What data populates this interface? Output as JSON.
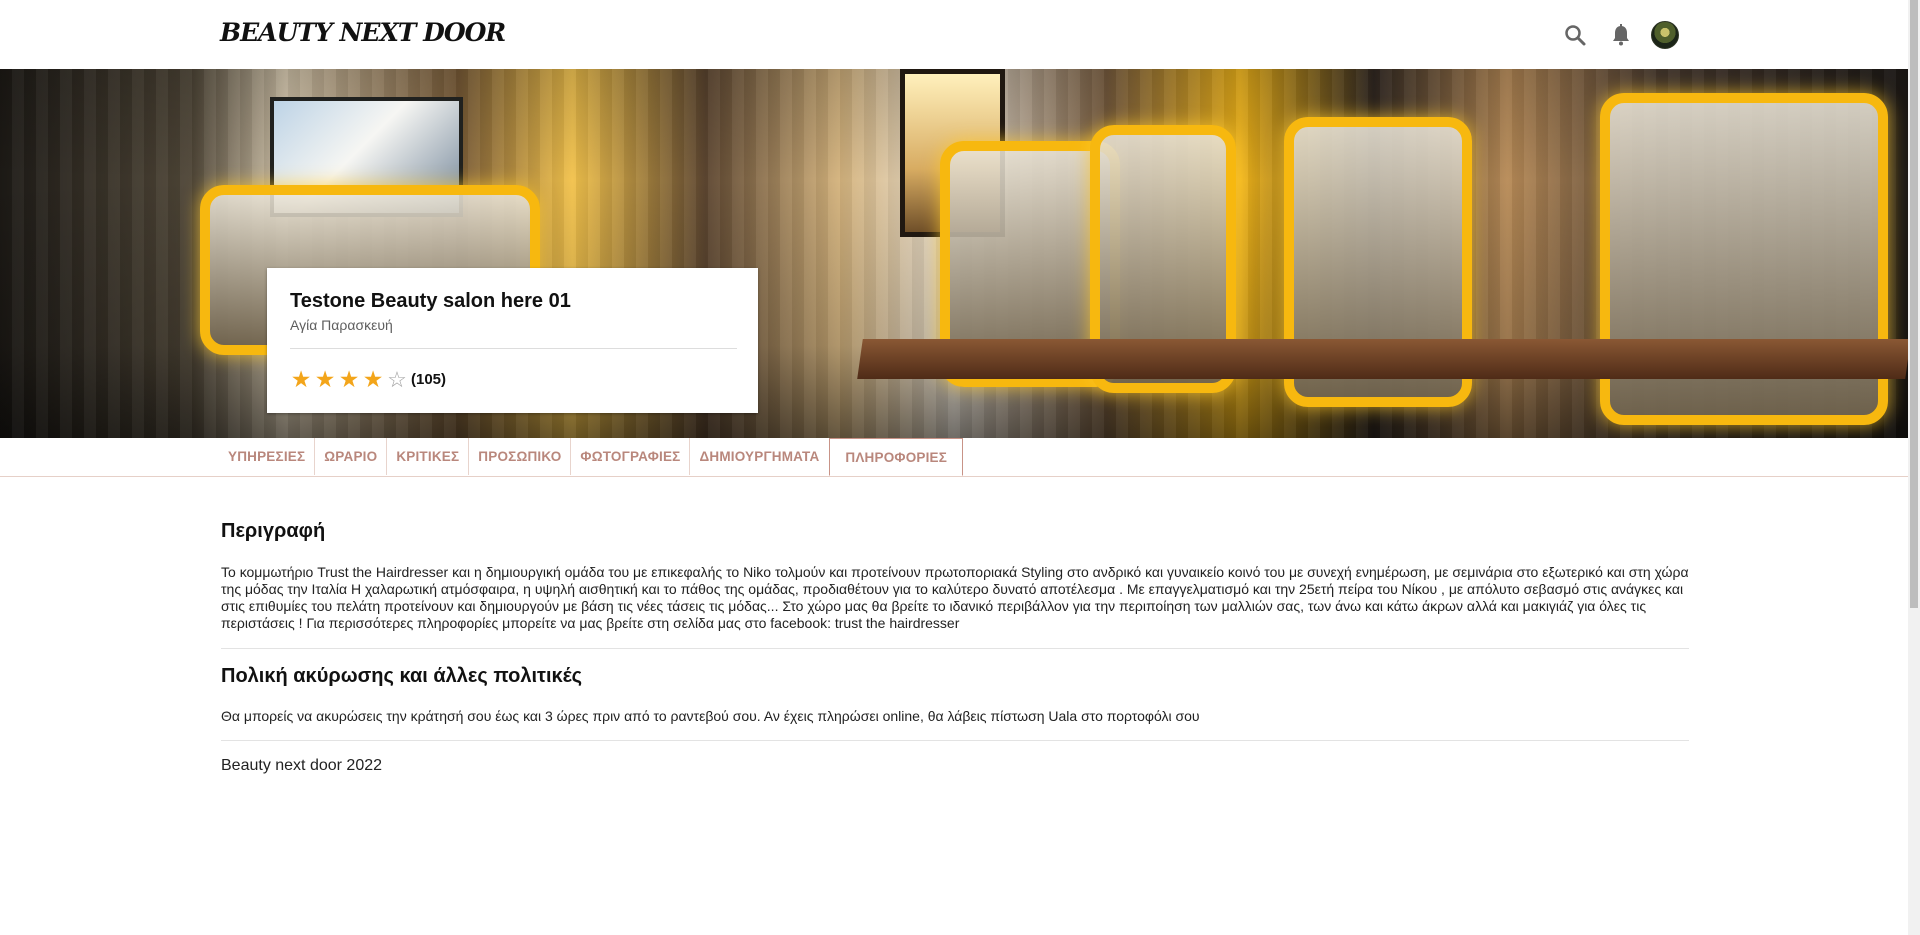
{
  "header": {
    "brand": "BEAUTY NEXT DOOR",
    "icons": [
      "search-icon",
      "bell-icon",
      "avatar"
    ]
  },
  "salon": {
    "name": "Testone Beauty salon here 01",
    "location": "Αγία Παρασκευή",
    "rating": 4,
    "rating_max": 5,
    "review_count": "(105)"
  },
  "tabs": [
    {
      "label": "ΥΠΗΡΕΣΙΕΣ",
      "active": false
    },
    {
      "label": "ΩΡΑΡΙΟ",
      "active": false
    },
    {
      "label": "ΚΡΙΤΙΚΕΣ",
      "active": false
    },
    {
      "label": "ΠΡΟΣΩΠΙΚΟ",
      "active": false
    },
    {
      "label": "ΦΩΤΟΓΡΑΦΙΕΣ",
      "active": false
    },
    {
      "label": "ΔΗΜΙΟΥΡΓΗΜΑΤΑ",
      "active": false
    },
    {
      "label": "ΠΛΗΡΟΦΟΡΙΕΣ",
      "active": true
    }
  ],
  "description": {
    "title": "Περιγραφή",
    "text": "Το κομμωτήριο Trust the Hairdresser και η δημιουργική ομάδα του με επικεφαλής το Niko τολμούν και προτείνουν πρωτοποριακά Styling στο ανδρικό και γυναικείο κοινό του με συνεχή ενημέρωση, με σεμινάρια στο εξωτερικό και στη χώρα της μόδας την Ιταλία Η χαλαρωτική ατμόσφαιρα, η υψηλή αισθητική και το πάθος της ομάδας, προδιαθέτουν για το καλύτερο δυνατό αποτέλεσμα . Με επαγγελματισμό και την 25ετή πείρα του Νίκου , με απόλυτο σεβασμό στις ανάγκες και στις επιθυμίες του πελάτη προτείνουν και δημιουργούν με βάση τις νέες τάσεις τις μόδας... Στο χώρο μας θα βρείτε το ιδανικό περιβάλλον για την περιποίηση των μαλλιών σας, των άνω και κάτω άκρων αλλά και μακιγιάζ για όλες τις περιστάσεις ! Για περισσότερες πληροφορίες μπορείτε να μας βρείτε στη σελίδα μας στο facebook: trust the hairdresser"
  },
  "policy": {
    "title": "Πολική ακύρωσης και άλλες πολιτικές",
    "text": "Θα μπορείς να ακυρώσεις την κράτησή σου έως και 3 ώρες πριν από το ραντεβού σου. Αν έχεις πληρώσει online, θα λάβεις πίστωση Uala στο πορτοφόλι σου"
  },
  "footer": {
    "text": "Beauty next door 2022"
  },
  "colors": {
    "star": "#f3a51a",
    "tab_text": "#b9877c",
    "tab_active_border": "#c89387"
  }
}
